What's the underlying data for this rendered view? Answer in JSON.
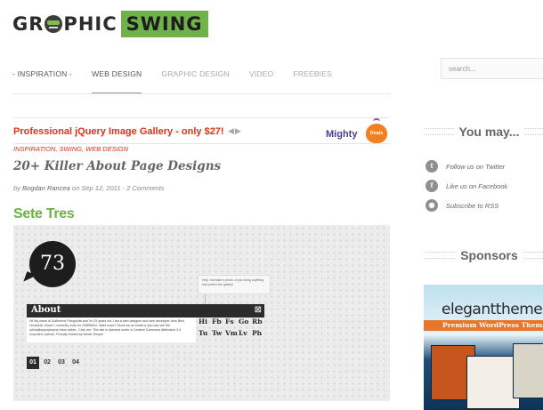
{
  "header": {
    "logo_left": "GR",
    "logo_mid": "PHIC",
    "logo_right": "SWING",
    "nav": [
      {
        "label": "- Inspiration -",
        "state": "active"
      },
      {
        "label": "Web Design",
        "state": "current"
      },
      {
        "label": "Graphic Design",
        "state": "normal"
      },
      {
        "label": "Video",
        "state": "normal"
      },
      {
        "label": "Freebies",
        "state": "normal"
      }
    ],
    "search_placeholder": "search..."
  },
  "promo": {
    "text": "Professional jQuery Image Gallery - only $27!",
    "arrows": "◀▶",
    "brand_word": "Mighty",
    "brand_badge": "Deals"
  },
  "post": {
    "categories": "Inspiration, Swing, Web Design",
    "title": "20+ Killer About Page Designs",
    "byline_prefix": "by",
    "author": "Bogdan Rancea",
    "date_prefix": "on",
    "date": "Sep 12, 2011",
    "separator": "-",
    "comments": "2 Comments",
    "section_heading": "Sete Tres"
  },
  "screenshot": {
    "badge_number": "73",
    "note_text": "Hey! Just take a photo of you doing anything and post in the gallery!",
    "about_label": "About",
    "close_glyph": "⊠",
    "about_body": "Hi! My name is Guilherme Pangnotta and I'm 25 years old. I am a web designer and web developer from Belo Horizonte, Brazil. I currently work for JOBSMAX. Want more? Send me an email or you can see the urlshplikepeopleprok fotos below - Click me. This site is licensed under a Creative Commons Attribution 3.0 Unported License. Proudly Hosted by Media Temple.",
    "fonts_row1": [
      "Hi",
      "Fb",
      "Fs",
      "Go",
      "Rb"
    ],
    "fonts_row2": [
      "Tu",
      "Tw",
      "Vm",
      "Lv",
      "Ph"
    ],
    "pager": [
      "01",
      "02",
      "03",
      "04"
    ]
  },
  "sidebar": {
    "heading_1": "You may...",
    "social": [
      {
        "icon": "twitter-icon",
        "glyph": "t",
        "label": "Follow us on Twitter"
      },
      {
        "icon": "facebook-icon",
        "glyph": "f",
        "label": "Like us on Facebook"
      },
      {
        "icon": "rss-icon",
        "glyph": "◉",
        "label": "Subscribe to RSS"
      }
    ],
    "heading_2": "Sponsors",
    "ad_title": "elegantthemes",
    "ad_sub": "Premium WordPress Themes"
  },
  "colors": {
    "brand_green": "#6fb24a",
    "promo_red": "#e1321c",
    "heading_green": "#6cb244"
  }
}
